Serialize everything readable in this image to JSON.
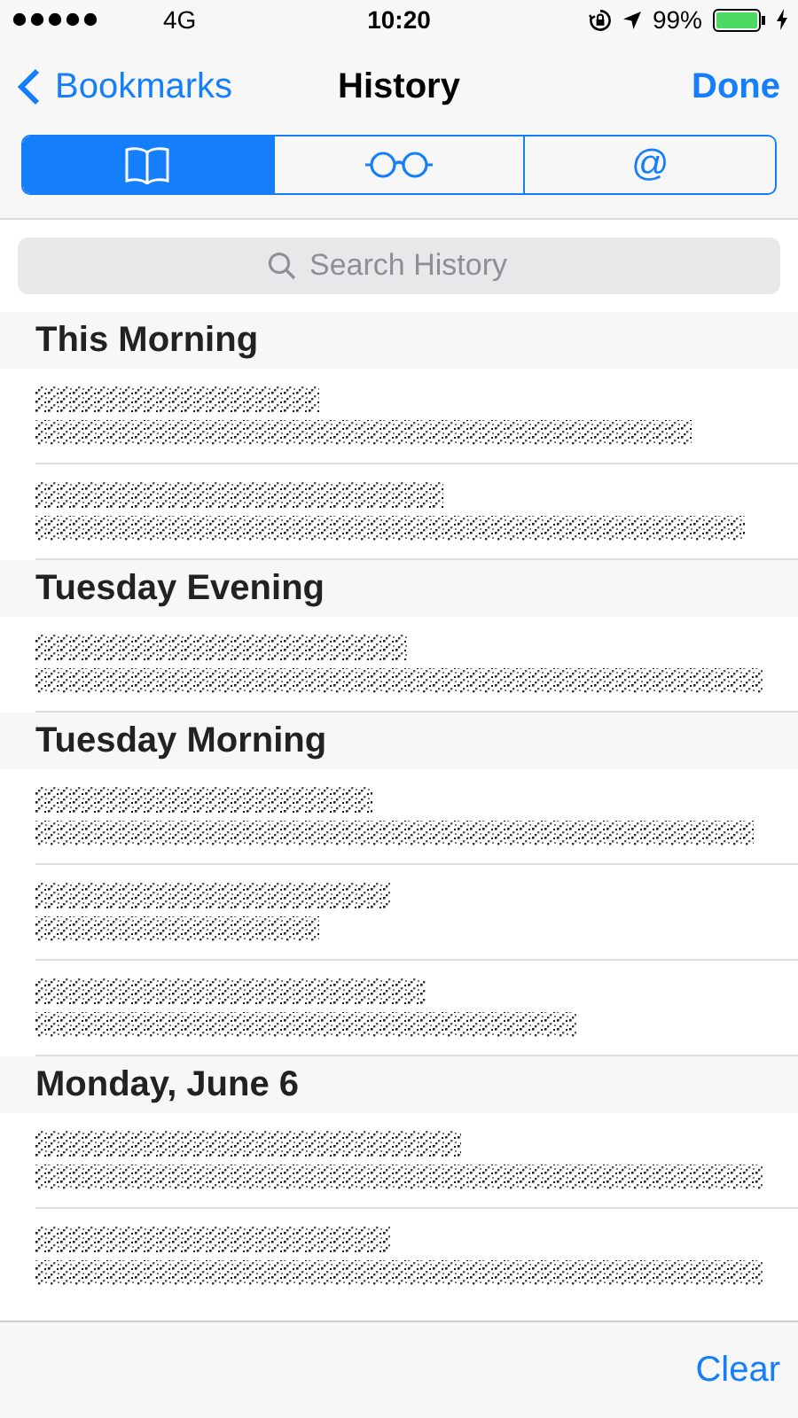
{
  "status_bar": {
    "carrier": "4G",
    "time": "10:20",
    "battery": "99%"
  },
  "nav": {
    "back": "Bookmarks",
    "title": "History",
    "done": "Done"
  },
  "tabs": [
    {
      "kind": "book",
      "selected": true
    },
    {
      "kind": "glasses",
      "selected": false
    },
    {
      "kind": "text",
      "label": "@",
      "selected": false
    }
  ],
  "search": {
    "placeholder": "Search History"
  },
  "sections": [
    {
      "title": "This Morning",
      "rows": [
        {
          "kind": "redacted"
        },
        {
          "kind": "redacted"
        }
      ]
    },
    {
      "title": "Tuesday Evening",
      "rows": [
        {
          "kind": "redacted"
        }
      ]
    },
    {
      "title": "Tuesday Morning",
      "rows": [
        {
          "kind": "redacted"
        },
        {
          "kind": "redacted"
        },
        {
          "kind": "redacted"
        }
      ]
    },
    {
      "title": "Monday, June 6",
      "rows": [
        {
          "kind": "redacted"
        },
        {
          "kind": "redacted"
        }
      ]
    }
  ],
  "toolbar": {
    "clear": "Clear"
  }
}
